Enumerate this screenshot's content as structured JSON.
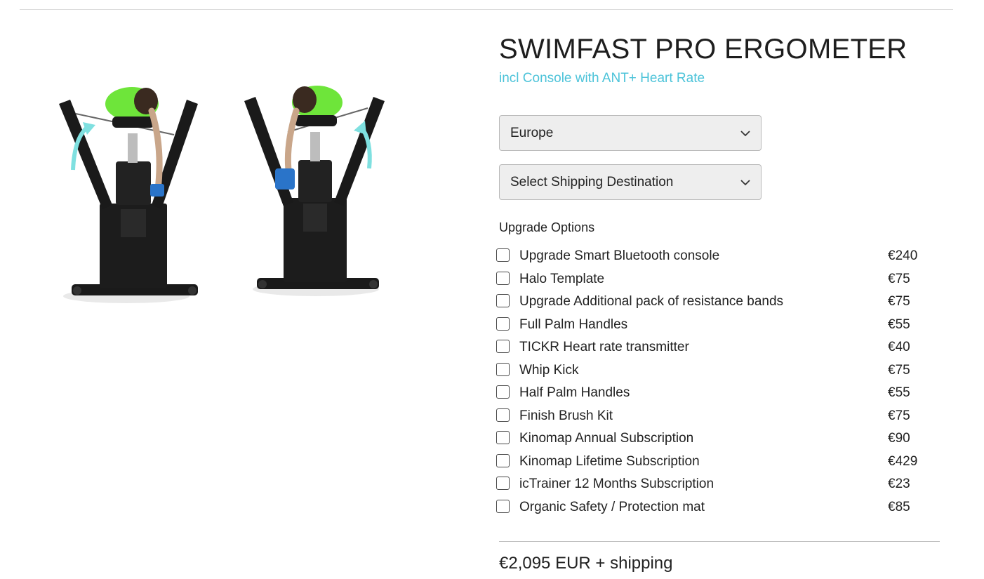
{
  "product": {
    "title": "SWIMFAST PRO ERGOMETER",
    "subtitle": "incl Console with ANT+ Heart Rate",
    "image_alt": "Swimfast Pro Ergometer swimmer training bench, two views"
  },
  "selects": {
    "region": {
      "value": "Europe"
    },
    "shipping": {
      "value": "Select Shipping Destination"
    }
  },
  "upgrades": {
    "heading": "Upgrade Options",
    "items": [
      {
        "label": "Upgrade Smart Bluetooth console",
        "price": "€240",
        "checked": false
      },
      {
        "label": "Halo Template",
        "price": "€75",
        "checked": false
      },
      {
        "label": "Upgrade Additional pack of resistance bands",
        "price": "€75",
        "checked": false
      },
      {
        "label": "Full Palm Handles",
        "price": "€55",
        "checked": false
      },
      {
        "label": "TICKR Heart rate transmitter",
        "price": "€40",
        "checked": false
      },
      {
        "label": "Whip Kick",
        "price": "€75",
        "checked": false
      },
      {
        "label": "Half Palm Handles",
        "price": "€55",
        "checked": false
      },
      {
        "label": "Finish Brush Kit",
        "price": "€75",
        "checked": false
      },
      {
        "label": "Kinomap Annual Subscription",
        "price": "€90",
        "checked": false
      },
      {
        "label": "Kinomap Lifetime Subscription",
        "price": "€429",
        "checked": false
      },
      {
        "label": "icTrainer 12 Months Subscription",
        "price": "€23",
        "checked": false
      },
      {
        "label": "Organic Safety / Protection mat",
        "price": "€85",
        "checked": false
      }
    ]
  },
  "total": {
    "text": "€2,095 EUR + shipping"
  },
  "colors": {
    "accent": "#4cc3d9",
    "shirt": "#6ee53a",
    "machine": "#1a1a1a",
    "arrow": "#7fe0e0"
  },
  "icons": {
    "select_chevron": "chevron-down-icon",
    "checkbox": "checkbox-unchecked-icon"
  }
}
